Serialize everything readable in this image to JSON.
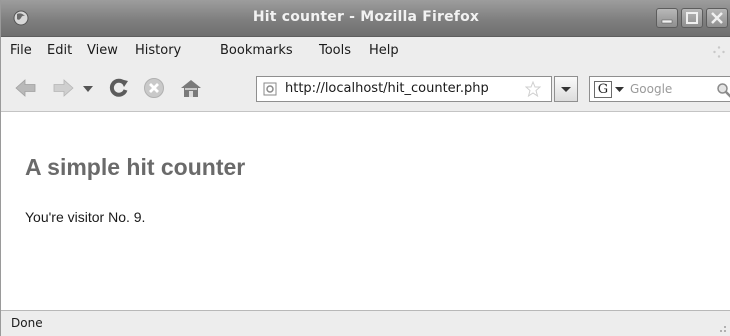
{
  "window": {
    "title": "Hit counter - Mozilla Firefox"
  },
  "menubar": {
    "items": [
      {
        "label": "File"
      },
      {
        "label": "Edit"
      },
      {
        "label": "View"
      },
      {
        "label": "History"
      },
      {
        "label": "Bookmarks"
      },
      {
        "label": "Tools"
      },
      {
        "label": "Help"
      }
    ]
  },
  "toolbar": {
    "url": "http://localhost/hit_counter.php",
    "search_placeholder": "Google",
    "search_engine": "G"
  },
  "page": {
    "heading": "A simple hit counter",
    "text": "You're visitor No. 9."
  },
  "status": {
    "text": "Done"
  },
  "icons": {
    "app": "firefox-icon",
    "back": "back-arrow-icon",
    "forward": "forward-arrow-icon",
    "history_dropdown": "dropdown-caret-icon",
    "reload": "reload-icon",
    "stop": "stop-icon",
    "home": "home-icon",
    "bookmark": "star-icon",
    "search": "magnifier-icon"
  },
  "colors": {
    "titlebar": "#7f7f7f",
    "chrome": "#ededed",
    "heading": "#6a6a6a"
  }
}
